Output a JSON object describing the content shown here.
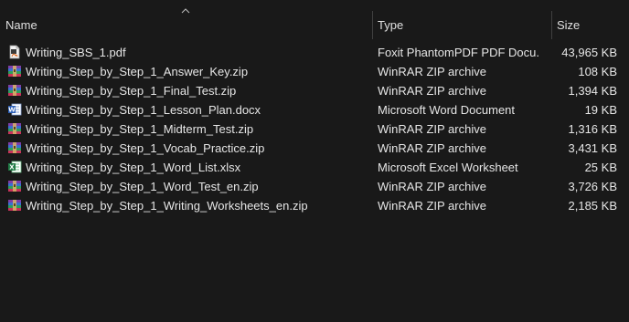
{
  "columns": {
    "name": "Name",
    "type": "Type",
    "size": "Size"
  },
  "files": [
    {
      "name": "Writing_SBS_1.pdf",
      "type": "Foxit PhantomPDF PDF Docu...",
      "size": "43,965 KB",
      "icon": "pdf-icon"
    },
    {
      "name": "Writing_Step_by_Step_1_Answer_Key.zip",
      "type": "WinRAR ZIP archive",
      "size": "108 KB",
      "icon": "winrar-icon"
    },
    {
      "name": "Writing_Step_by_Step_1_Final_Test.zip",
      "type": "WinRAR ZIP archive",
      "size": "1,394 KB",
      "icon": "winrar-icon"
    },
    {
      "name": "Writing_Step_by_Step_1_Lesson_Plan.docx",
      "type": "Microsoft Word Document",
      "size": "19 KB",
      "icon": "word-icon"
    },
    {
      "name": "Writing_Step_by_Step_1_Midterm_Test.zip",
      "type": "WinRAR ZIP archive",
      "size": "1,316 KB",
      "icon": "winrar-icon"
    },
    {
      "name": "Writing_Step_by_Step_1_Vocab_Practice.zip",
      "type": "WinRAR ZIP archive",
      "size": "3,431 KB",
      "icon": "winrar-icon"
    },
    {
      "name": "Writing_Step_by_Step_1_Word_List.xlsx",
      "type": "Microsoft Excel Worksheet",
      "size": "25 KB",
      "icon": "excel-icon"
    },
    {
      "name": "Writing_Step_by_Step_1_Word_Test_en.zip",
      "type": "WinRAR ZIP archive",
      "size": "3,726 KB",
      "icon": "winrar-icon"
    },
    {
      "name": "Writing_Step_by_Step_1_Writing_Worksheets_en.zip",
      "type": "WinRAR ZIP archive",
      "size": "2,185 KB",
      "icon": "winrar-icon"
    }
  ],
  "colors": {
    "background": "#191919",
    "text": "#e6e6e6",
    "divider": "#3f3f3f"
  }
}
